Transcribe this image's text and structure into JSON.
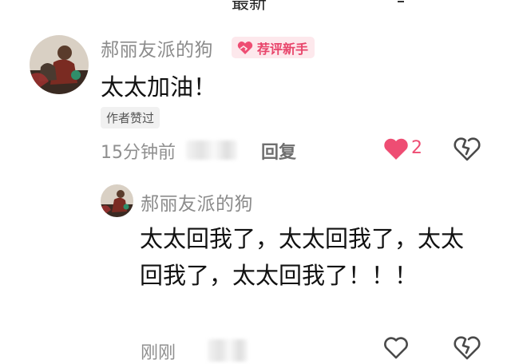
{
  "top_fragment": "最新",
  "comment": {
    "author": "郝丽友派的狗",
    "badge_label": "荐评新手",
    "text": "太太加油！",
    "liked_by_author_label": "作者赞过",
    "time": "15分钟前",
    "reply_label": "回复",
    "like_count": "2",
    "accent_color": "#ee4d73"
  },
  "reply": {
    "author": "郝丽友派的狗",
    "text": "太太回我了，太太回我了，太太回我了，太太回我了！！！",
    "time": "刚刚"
  }
}
